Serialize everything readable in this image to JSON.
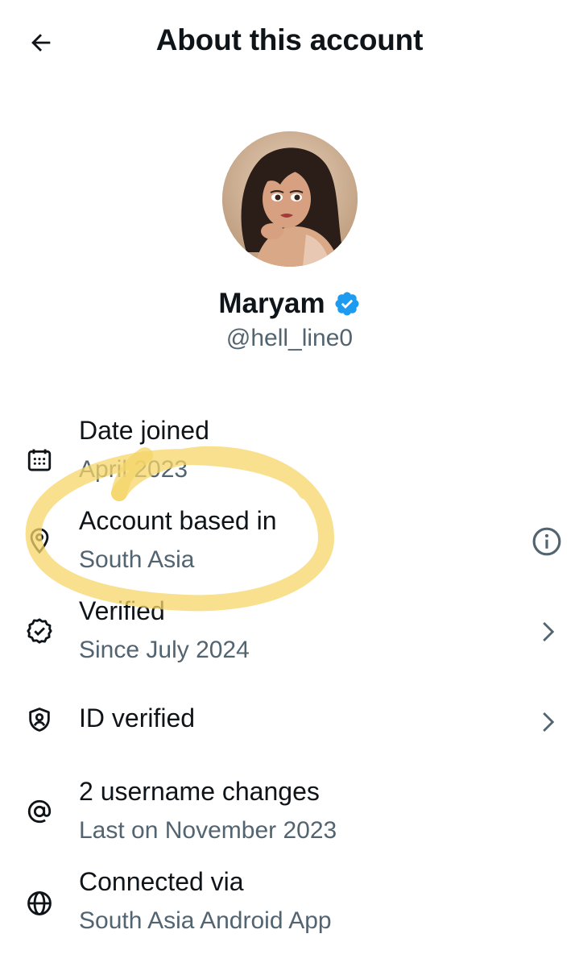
{
  "header": {
    "title": "About this account",
    "back_icon": "arrow-left-icon"
  },
  "profile": {
    "name": "Maryam",
    "handle": "@hell_line0",
    "verified_icon": "verified-badge-icon",
    "badge_color": "#1d9bf0"
  },
  "rows": [
    {
      "label": "Date joined",
      "sub": "April 2023",
      "icon": "calendar-icon"
    },
    {
      "label": "Account based in",
      "sub": "South Asia",
      "icon": "location-pin-icon",
      "trailing": "info-icon"
    },
    {
      "label": "Verified",
      "sub": "Since July 2024",
      "icon": "verified-check-icon",
      "trailing": "chevron-right-icon"
    },
    {
      "label": "ID verified",
      "icon": "shield-user-icon",
      "trailing": "chevron-right-icon"
    },
    {
      "label": "2 username changes",
      "sub": "Last on November 2023",
      "icon": "at-sign-icon"
    },
    {
      "label": "Connected via",
      "sub": "South Asia Android App",
      "icon": "globe-icon"
    }
  ],
  "colors": {
    "text_primary": "#0f1419",
    "text_secondary": "#536471",
    "highlight": "#f5d668"
  }
}
